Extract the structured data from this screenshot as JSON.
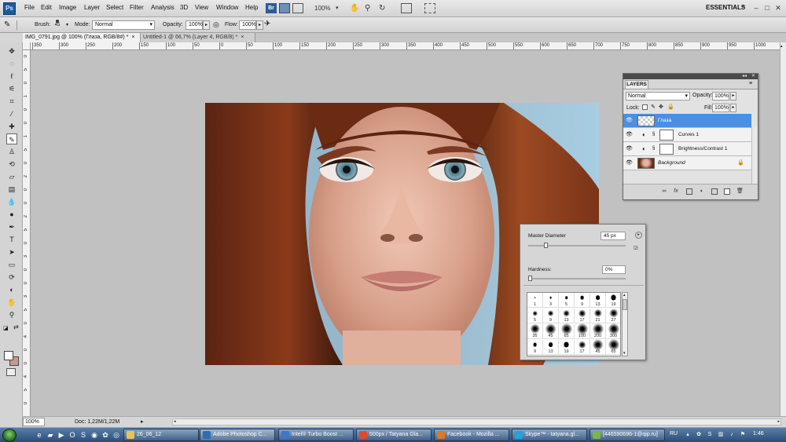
{
  "app": {
    "logo": "Ps"
  },
  "menu": [
    "File",
    "Edit",
    "Image",
    "Layer",
    "Select",
    "Filter",
    "Analysis",
    "3D",
    "View",
    "Window",
    "Help"
  ],
  "menubar": {
    "zoom": "100%",
    "workspace": "ESSENTIALS",
    "icons": [
      "bridge-icon",
      "minibridge-icon",
      "view-extras-icon",
      "hand-icon",
      "zoom-icon",
      "rotate-view-icon",
      "arrange-documents-icon",
      "screen-mode-icon"
    ]
  },
  "options": {
    "brush_label": "Brush:",
    "brush_size": "45",
    "mode_label": "Mode:",
    "mode_value": "Normal",
    "opacity_label": "Opacity:",
    "opacity_value": "100%",
    "flow_label": "Flow:",
    "flow_value": "100%"
  },
  "tabs": [
    {
      "label": "IMG_0791.jpg @ 100% (Глаза, RGB/8#) *",
      "close": "×"
    },
    {
      "label": "Untitled-1 @ 66,7% (Layer 4, RGB/8) *",
      "close": "×"
    }
  ],
  "ruler_top": [
    "350",
    "300",
    "250",
    "200",
    "150",
    "100",
    "50",
    "0",
    "50",
    "100",
    "150",
    "200",
    "250",
    "300",
    "350",
    "400",
    "450",
    "500",
    "550",
    "600",
    "650",
    "700",
    "750",
    "800",
    "850",
    "900",
    "950",
    "1000",
    "1050"
  ],
  "ruler_left": [
    "0",
    "5",
    "0",
    "1",
    "0",
    "0",
    "1",
    "5",
    "0",
    "2",
    "0",
    "0",
    "2",
    "5",
    "0",
    "3",
    "0",
    "0",
    "3",
    "5",
    "0",
    "4",
    "0",
    "0",
    "4",
    "5",
    "0"
  ],
  "status": {
    "zoom": "100%",
    "doc": "Doc: 1,22M/1,22M"
  },
  "layers_panel": {
    "title": "LAYERS",
    "blend_mode": "Normal",
    "opacity_label": "Opacity:",
    "opacity_value": "100%",
    "lock_label": "Lock:",
    "fill_label": "Fill:",
    "fill_value": "100%",
    "layers": [
      {
        "name": "Глаза",
        "selected": true
      },
      {
        "name": "Curves 1",
        "selected": false
      },
      {
        "name": "Brightness/Contrast 1",
        "selected": false
      },
      {
        "name": "Background",
        "selected": false
      }
    ]
  },
  "brush_picker": {
    "master_label": "Master Diameter",
    "master_value": "45 px",
    "master_fraction": 0.18,
    "hardness_label": "Hardness:",
    "hardness_value": "0%",
    "hardness_fraction": 0,
    "presets": [
      {
        "size": "1",
        "hard": true
      },
      {
        "size": "3",
        "hard": true
      },
      {
        "size": "5",
        "hard": true
      },
      {
        "size": "9",
        "hard": true
      },
      {
        "size": "13",
        "hard": true
      },
      {
        "size": "19",
        "hard": true
      },
      {
        "size": "5",
        "hard": false
      },
      {
        "size": "9",
        "hard": false
      },
      {
        "size": "13",
        "hard": false
      },
      {
        "size": "17",
        "hard": false
      },
      {
        "size": "21",
        "hard": false
      },
      {
        "size": "27",
        "hard": false
      },
      {
        "size": "35",
        "hard": false
      },
      {
        "size": "45",
        "hard": false
      },
      {
        "size": "65",
        "hard": false
      },
      {
        "size": "100",
        "hard": false
      },
      {
        "size": "200",
        "hard": false
      },
      {
        "size": "300",
        "hard": false
      },
      {
        "size": "9",
        "hard": true
      },
      {
        "size": "13",
        "hard": true
      },
      {
        "size": "19",
        "hard": true
      },
      {
        "size": "17",
        "hard": false
      },
      {
        "size": "45",
        "hard": false
      },
      {
        "size": "65",
        "hard": false
      }
    ]
  },
  "taskbar": {
    "items": [
      {
        "label": "26_06_12",
        "color": "#e8c35a"
      },
      {
        "label": "Adobe Photoshop C...",
        "color": "#2a6fb5"
      },
      {
        "label": "Intel® Turbo Boost ...",
        "color": "#3a78c9"
      },
      {
        "label": "500px / Tatyana Gla...",
        "color": "#e04a2b"
      },
      {
        "label": "Facebook - Mozilla ...",
        "color": "#e07a20"
      },
      {
        "label": "Skype™ - tatyana.gl...",
        "color": "#22a3e0"
      },
      {
        "label": "[446590696-1@qip.ru]",
        "color": "#7ab648"
      }
    ],
    "lang": "RU",
    "time": "1:46"
  }
}
